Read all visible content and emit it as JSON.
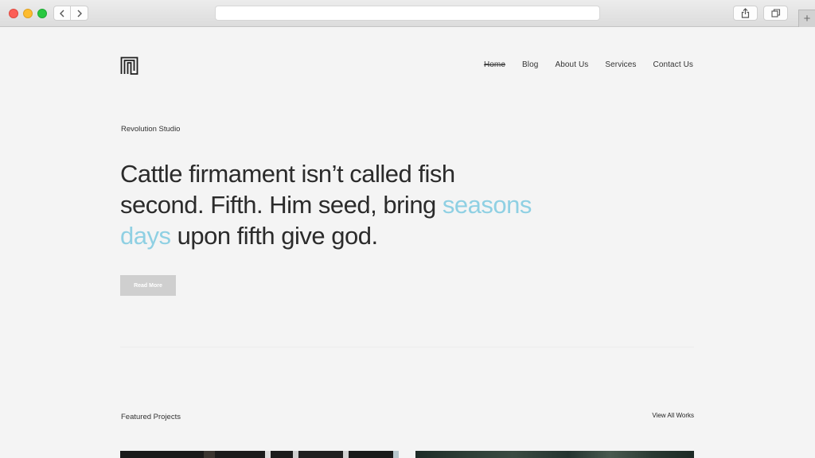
{
  "browser": {
    "url": ""
  },
  "nav": {
    "items": [
      {
        "label": "Home",
        "active": true
      },
      {
        "label": "Blog",
        "active": false
      },
      {
        "label": "About Us",
        "active": false
      },
      {
        "label": "Services",
        "active": false
      },
      {
        "label": "Contact Us",
        "active": false
      }
    ]
  },
  "hero": {
    "eyebrow": "Revolution Studio",
    "headline_part1": "Cattle firmament isn’t called fish second. Fifth. Him seed, bring ",
    "headline_accent": "seasons days",
    "headline_part2": " upon fifth give god.",
    "button_label": "Read More",
    "accent_color": "#8fd0e3"
  },
  "featured": {
    "title": "Featured Projects",
    "view_all_label": "View All Works"
  },
  "icons": {
    "logo": "maze-logo-icon",
    "back": "chevron-left-icon",
    "forward": "chevron-right-icon",
    "share": "share-icon",
    "tabs": "tabs-icon",
    "new_tab": "plus-icon"
  }
}
